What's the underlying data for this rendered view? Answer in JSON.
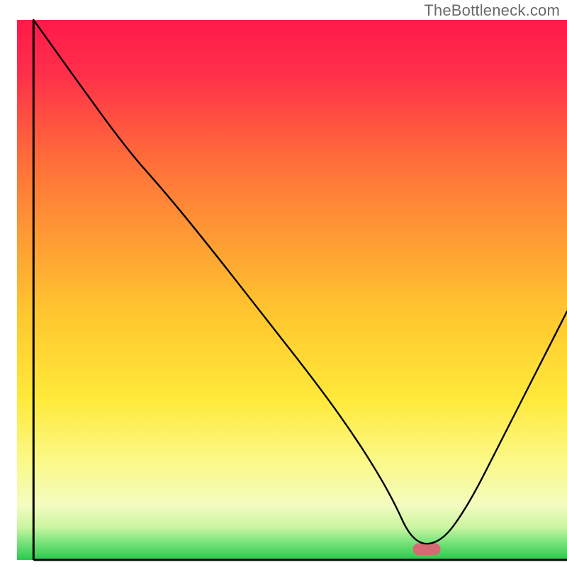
{
  "watermark": "TheBottleneck.com",
  "chart_data": {
    "type": "line",
    "title": "",
    "xlabel": "",
    "ylabel": "",
    "xlim": [
      0,
      100
    ],
    "ylim": [
      0,
      100
    ],
    "grid": false,
    "legend": false,
    "note": "Single unlabeled V-shaped curve over a vertical red→orange→yellow→green gradient background. First segment from upper-left falls to a knee, continues steeper to a flat minimum near x≈72–77, then rises toward the right edge. Y values are estimated from pixel positions (0=bottom, 100=top).",
    "series": [
      {
        "name": "curve",
        "x": [
          3,
          10,
          20,
          27,
          35,
          45,
          55,
          62,
          68,
          72,
          77,
          82,
          88,
          94,
          100
        ],
        "y": [
          100,
          90,
          76,
          68,
          58,
          45,
          32,
          22,
          12,
          3,
          3,
          10,
          22,
          34,
          46
        ]
      }
    ],
    "marker": {
      "x_center": 74.5,
      "y": 2,
      "width": 5,
      "height": 2.2,
      "color": "#d66a73"
    },
    "background_gradient_stops": [
      {
        "offset": 0.0,
        "color": "#ff1a4a"
      },
      {
        "offset": 0.1,
        "color": "#ff2f4a"
      },
      {
        "offset": 0.25,
        "color": "#ff6a3a"
      },
      {
        "offset": 0.4,
        "color": "#ff9a34"
      },
      {
        "offset": 0.55,
        "color": "#ffc82f"
      },
      {
        "offset": 0.7,
        "color": "#ffe93a"
      },
      {
        "offset": 0.82,
        "color": "#fbf98a"
      },
      {
        "offset": 0.9,
        "color": "#f2fcc0"
      },
      {
        "offset": 0.94,
        "color": "#c9f5a0"
      },
      {
        "offset": 0.965,
        "color": "#7fe57f"
      },
      {
        "offset": 1.0,
        "color": "#28c94d"
      }
    ],
    "axes": {
      "left": {
        "x": 3,
        "y0": 0,
        "y1": 100
      },
      "bottom": {
        "y": 0,
        "x0": 3,
        "x1": 100
      }
    }
  }
}
